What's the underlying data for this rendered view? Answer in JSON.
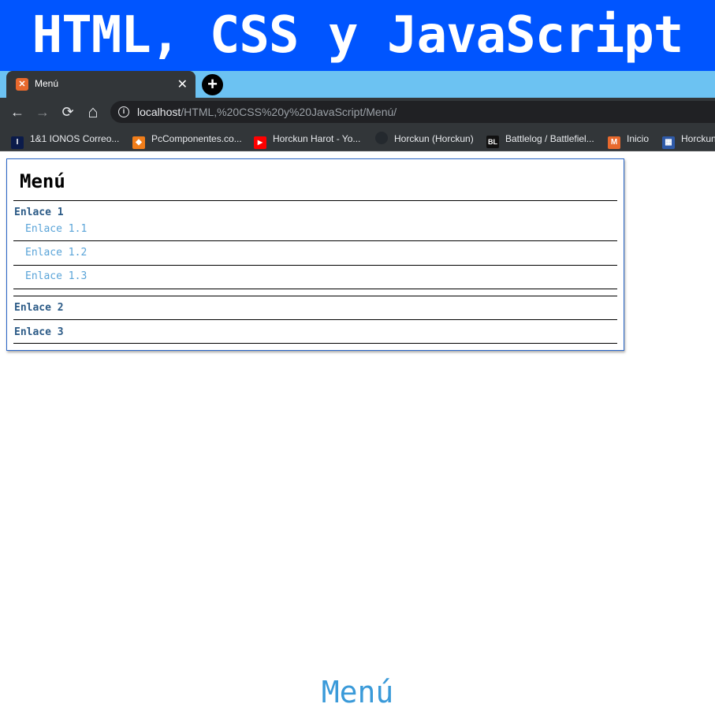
{
  "banner": {
    "title": "HTML, CSS y JavaScript"
  },
  "browser": {
    "tab": {
      "title": "Menú",
      "favicon_icon": "xampp-icon",
      "close_label": "✕"
    },
    "new_tab_label": "+",
    "nav": {
      "back": "←",
      "forward": "→",
      "reload": "⟳",
      "home": "⌂"
    },
    "address": {
      "host": "localhost",
      "path": "/HTML,%20CSS%20y%20JavaScript/Menú/"
    },
    "bookmarks": [
      {
        "label": "1&1 IONOS Correo...",
        "icon": "ionos-icon",
        "icon_color": "#0b1b4a",
        "glyph": "I"
      },
      {
        "label": "PcComponentes.co...",
        "icon": "pccomponentes-icon",
        "icon_color": "#f07d1a",
        "glyph": "◆"
      },
      {
        "label": "Horckun Harot - Yo...",
        "icon": "youtube-icon",
        "icon_color": "#ff0000",
        "glyph": "▶"
      },
      {
        "label": "Horckun (Horckun)",
        "icon": "github-icon",
        "icon_color": "#24292e",
        "glyph": "●"
      },
      {
        "label": "Battlelog / Battlefiel...",
        "icon": "battlelog-icon",
        "icon_color": "#111111",
        "glyph": "BL"
      },
      {
        "label": "Inicio",
        "icon": "inicio-icon",
        "icon_color": "#e8692d",
        "glyph": "M"
      },
      {
        "label": "Horckun",
        "icon": "grid-icon",
        "icon_color": "#2f5aa8",
        "glyph": "▦"
      }
    ]
  },
  "page": {
    "menu_title": "Menú",
    "links": {
      "enlace1": "Enlace 1",
      "enlace1_1": "Enlace 1.1",
      "enlace1_2": "Enlace 1.2",
      "enlace1_3": "Enlace 1.3",
      "enlace2": "Enlace 2",
      "enlace3": "Enlace 3"
    }
  },
  "caption": "Menú",
  "colors": {
    "banner": "#0055ff",
    "tabstrip": "#6cc2f2",
    "chrome": "#323639",
    "caption": "#3a9ad9"
  }
}
